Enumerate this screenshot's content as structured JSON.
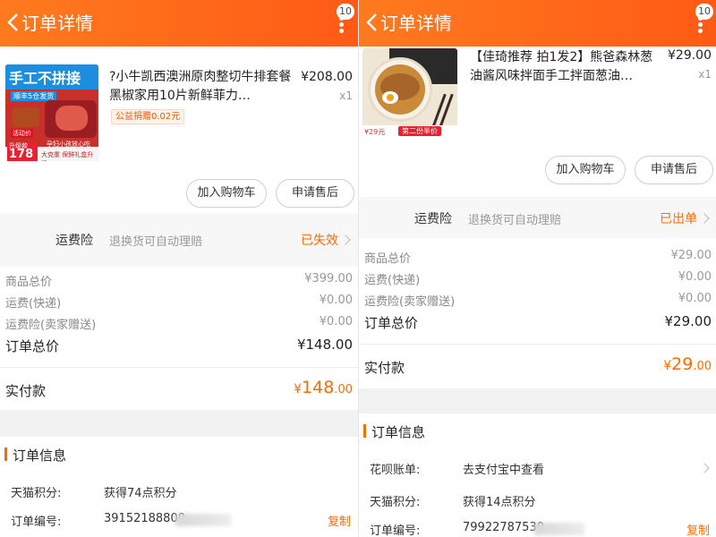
{
  "left": {
    "header": {
      "title": "订单详情",
      "badge": "10"
    },
    "product": {
      "image_text": {
        "banner": "手工不拼接",
        "sub_banner": "顺丰5仓发货",
        "sticker": "活动价",
        "promo_line1": "孕妇小孩放心吃",
        "promo_line2": "大克重 保鲜礼盒升级",
        "deal_label": "升级款",
        "deal_price": "178"
      },
      "name": "?小牛凯西澳洲原肉整切牛排套餐黑椒家用10片新鲜菲力…",
      "price": "¥208.00",
      "qty": "x1",
      "charity_tag": "公益捐赠0.02元"
    },
    "actions": {
      "add_cart": "加入购物车",
      "after_sale": "申请售后"
    },
    "shipping_insurance": {
      "label": "运费险",
      "desc": "退换货可自动理赔",
      "status": "已失效"
    },
    "summary": {
      "goods_total_label": "商品总价",
      "goods_total": "¥399.00",
      "shipping_label": "运费(快递)",
      "shipping": "¥0.00",
      "insurance_label": "运费险(卖家赠送)",
      "insurance": "¥0.00",
      "order_total_label": "订单总价",
      "order_total": "¥148.00",
      "paid_label": "实付款",
      "paid_symbol": "¥",
      "paid_int": "148",
      "paid_dec": ".00"
    },
    "order_info": {
      "title": "订单信息",
      "points_label": "天猫积分:",
      "points_value": "获得74点积分",
      "order_no_label": "订单编号:",
      "order_no_value": "39152188800",
      "copy": "复制"
    }
  },
  "right": {
    "header": {
      "title": "订单详情",
      "badge": "10"
    },
    "product": {
      "image_text": {
        "price_tag": "¥29元",
        "promo": "第二份半价"
      },
      "name": "【佳琦推荐 拍1发2】熊爸森林葱油酱风味拌面手工拌面葱油…",
      "price": "¥29.00",
      "qty": "x1"
    },
    "actions": {
      "add_cart": "加入购物车",
      "after_sale": "申请售后"
    },
    "shipping_insurance": {
      "label": "运费险",
      "desc": "退换货可自动理赔",
      "status": "已出单"
    },
    "summary": {
      "goods_total_label": "商品总价",
      "goods_total": "¥29.00",
      "shipping_label": "运费(快递)",
      "shipping": "¥0.00",
      "insurance_label": "运费险(卖家赠送)",
      "insurance": "¥0.00",
      "order_total_label": "订单总价",
      "order_total": "¥29.00",
      "paid_label": "实付款",
      "paid_symbol": "¥",
      "paid_int": "29",
      "paid_dec": ".00"
    },
    "order_info": {
      "title": "订单信息",
      "huabei_label": "花呗账单:",
      "huabei_value": "去支付宝中查看",
      "points_label": "天猫积分:",
      "points_value": "获得14点积分",
      "order_no_label": "订单编号:",
      "order_no_value": "79922787530",
      "copy": "复制"
    }
  },
  "colors": {
    "brand_orange": "#ff6a00",
    "header_gradient_start": "#ff7a1e",
    "header_gradient_end": "#ff5a16"
  }
}
